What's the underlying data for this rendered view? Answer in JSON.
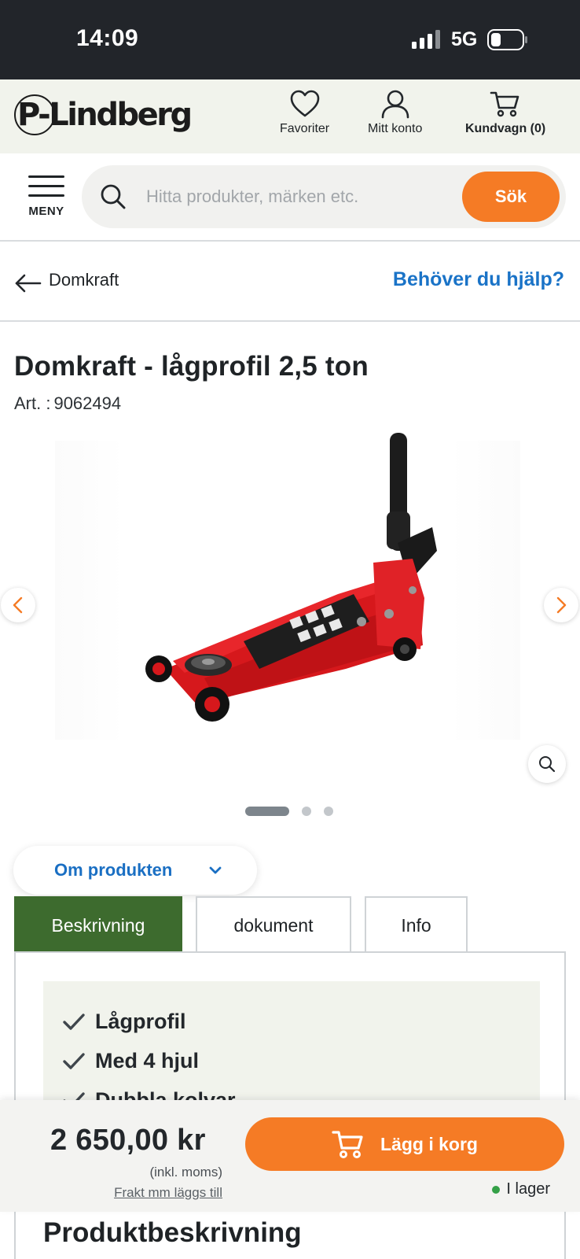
{
  "status_bar": {
    "time": "14:09",
    "network": "5G"
  },
  "header": {
    "logo_text": "P-Lindberg",
    "favorites_label": "Favoriter",
    "account_label": "Mitt konto",
    "cart_label": "Kundvagn (0)"
  },
  "search": {
    "menu_label": "MENY",
    "placeholder": "Hitta produkter, märken etc.",
    "button_label": "Sök"
  },
  "breadcrumb": {
    "back_label": "Domkraft",
    "help_link": "Behöver du hjälp?"
  },
  "product": {
    "title": "Domkraft - lågprofil 2,5 ton",
    "art_label": "Art. :",
    "art_number": "9062494",
    "image_count": 3,
    "active_image": 1
  },
  "about": {
    "label": "Om produkten"
  },
  "tabs": [
    {
      "label": "Beskrivning",
      "active": true
    },
    {
      "label": "dokument",
      "active": false
    },
    {
      "label": "Info",
      "active": false
    }
  ],
  "features": [
    "Lågprofil",
    "Med 4 hjul",
    "Dubbla kolvar"
  ],
  "description_heading": "Produktbeskrivning",
  "buy_bar": {
    "price": "2 650,00 kr",
    "vat_note": "(inkl. moms)",
    "shipping_note": "Frakt mm läggs till",
    "add_to_cart_label": "Lägg i korg",
    "stock_status": "I lager"
  },
  "colors": {
    "accent_orange": "#f57b25",
    "link_blue": "#1a73c7",
    "active_tab_green": "#3d6b2e",
    "stock_green": "#34a047",
    "header_bg": "#f1f3ec"
  }
}
